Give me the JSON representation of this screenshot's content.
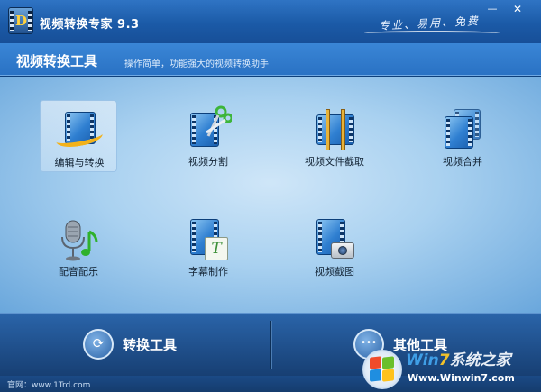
{
  "app": {
    "title": "视频转换专家 9.3",
    "slogan": "专业、易用、免费",
    "logo_letter": "D"
  },
  "window_controls": {
    "minimize": "—",
    "close": "✕"
  },
  "section": {
    "title": "视频转换工具",
    "description": "操作简单，功能强大的视频转换助手"
  },
  "tools": [
    {
      "label": "编辑与转换",
      "icon": "edit-convert-icon",
      "selected": true
    },
    {
      "label": "视频分割",
      "icon": "scissors-film-icon"
    },
    {
      "label": "视频文件截取",
      "icon": "film-clip-icon"
    },
    {
      "label": "视频合并",
      "icon": "film-merge-icon"
    },
    {
      "label": "配音配乐",
      "icon": "microphone-music-icon"
    },
    {
      "label": "字幕制作",
      "icon": "subtitle-icon"
    },
    {
      "label": "视频截图",
      "icon": "camera-film-icon"
    }
  ],
  "subtitle_glyph": "T",
  "bottom": {
    "left_label": "转换工具",
    "left_icon_glyph": "⟳",
    "right_label": "其他工具",
    "right_icon_glyph": "•••"
  },
  "status": {
    "url_text": "官网：www.1Trd.com"
  },
  "watermark": {
    "title_a": "Win",
    "title_b": "7",
    "title_c": "系统之家",
    "url": "Www.Winwin7.com"
  },
  "colors": {
    "titlebar": "#1b5aa7",
    "main_bg": "#a9d1f0",
    "bottombar": "#173f73"
  }
}
